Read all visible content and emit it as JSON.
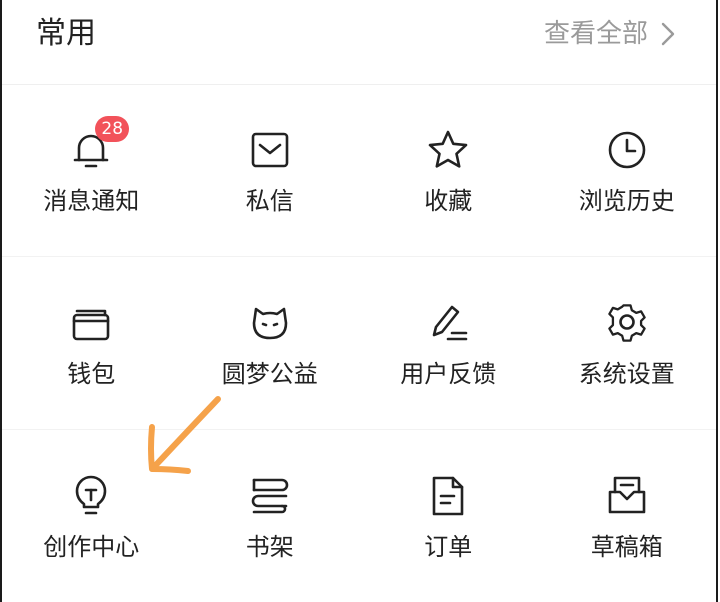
{
  "header": {
    "title": "常用",
    "view_all": "查看全部"
  },
  "rows": [
    [
      {
        "label": "消息通知",
        "icon": "bell-icon",
        "badge": "28"
      },
      {
        "label": "私信",
        "icon": "envelope-icon"
      },
      {
        "label": "收藏",
        "icon": "star-icon"
      },
      {
        "label": "浏览历史",
        "icon": "clock-icon"
      }
    ],
    [
      {
        "label": "钱包",
        "icon": "wallet-icon"
      },
      {
        "label": "圆梦公益",
        "icon": "cat-face-icon"
      },
      {
        "label": "用户反馈",
        "icon": "pen-icon"
      },
      {
        "label": "系统设置",
        "icon": "gear-icon"
      }
    ],
    [
      {
        "label": "创作中心",
        "icon": "lightbulb-icon"
      },
      {
        "label": "书架",
        "icon": "books-icon"
      },
      {
        "label": "订单",
        "icon": "document-icon"
      },
      {
        "label": "草稿箱",
        "icon": "inbox-icon"
      }
    ]
  ],
  "colors": {
    "badge": "#f2525a",
    "annotation_arrow": "#f5a24a",
    "muted_text": "#9a9a9a"
  }
}
